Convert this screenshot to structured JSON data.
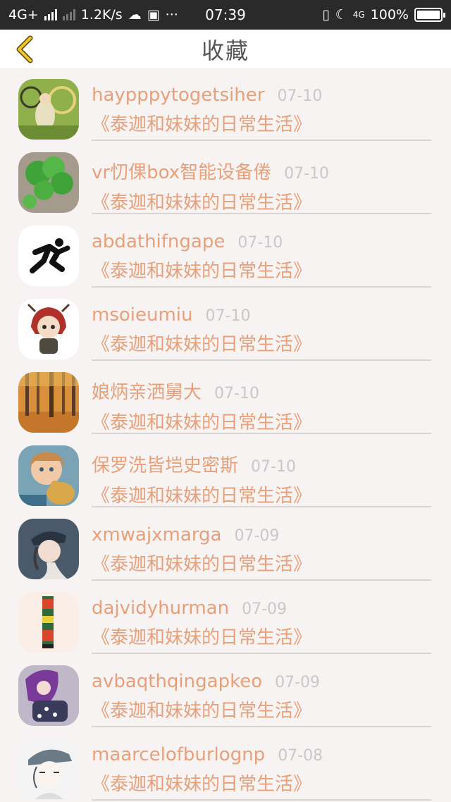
{
  "status_bar": {
    "network": "4G+",
    "speed": "1.2K/s",
    "more": "···",
    "time": "07:39",
    "network2": "4G",
    "battery": "100%"
  },
  "header": {
    "title": "收藏"
  },
  "items": [
    {
      "name": "haypppytogetsiher",
      "date": "07-10",
      "book": "《泰迦和妹妹的日常生活》",
      "avatar": "couple-bike"
    },
    {
      "name": "vr忉倮box智能设备倦",
      "date": "07-10",
      "book": "《泰迦和妹妹的日常生活》",
      "avatar": "clover"
    },
    {
      "name": "abdathifngape",
      "date": "07-10",
      "book": "《泰迦和妹妹的日常生活》",
      "avatar": "runner"
    },
    {
      "name": "msoieumiu",
      "date": "07-10",
      "book": "《泰迦和妹妹的日常生活》",
      "avatar": "anime-girl"
    },
    {
      "name": "娘炳亲洒舅大",
      "date": "07-10",
      "book": "《泰迦和妹妹的日常生活》",
      "avatar": "autumn-forest"
    },
    {
      "name": "保罗洗皆垲史密斯",
      "date": "07-10",
      "book": "《泰迦和妹妹的日常生活》",
      "avatar": "child-bear"
    },
    {
      "name": "xmwajxmarga",
      "date": "07-09",
      "book": "《泰迦和妹妹的日常生活》",
      "avatar": "woman-cap"
    },
    {
      "name": "dajvidyhurman",
      "date": "07-09",
      "book": "《泰迦和妹妹的日常生活》",
      "avatar": "stripe-art"
    },
    {
      "name": "avbaqthqingapkeo",
      "date": "07-09",
      "book": "《泰迦和妹妹的日常生活》",
      "avatar": "purple-girl"
    },
    {
      "name": "maarcelofburlognp",
      "date": "07-08",
      "book": "《泰迦和妹妹的日常生活》",
      "avatar": "sketch-boy"
    }
  ]
}
